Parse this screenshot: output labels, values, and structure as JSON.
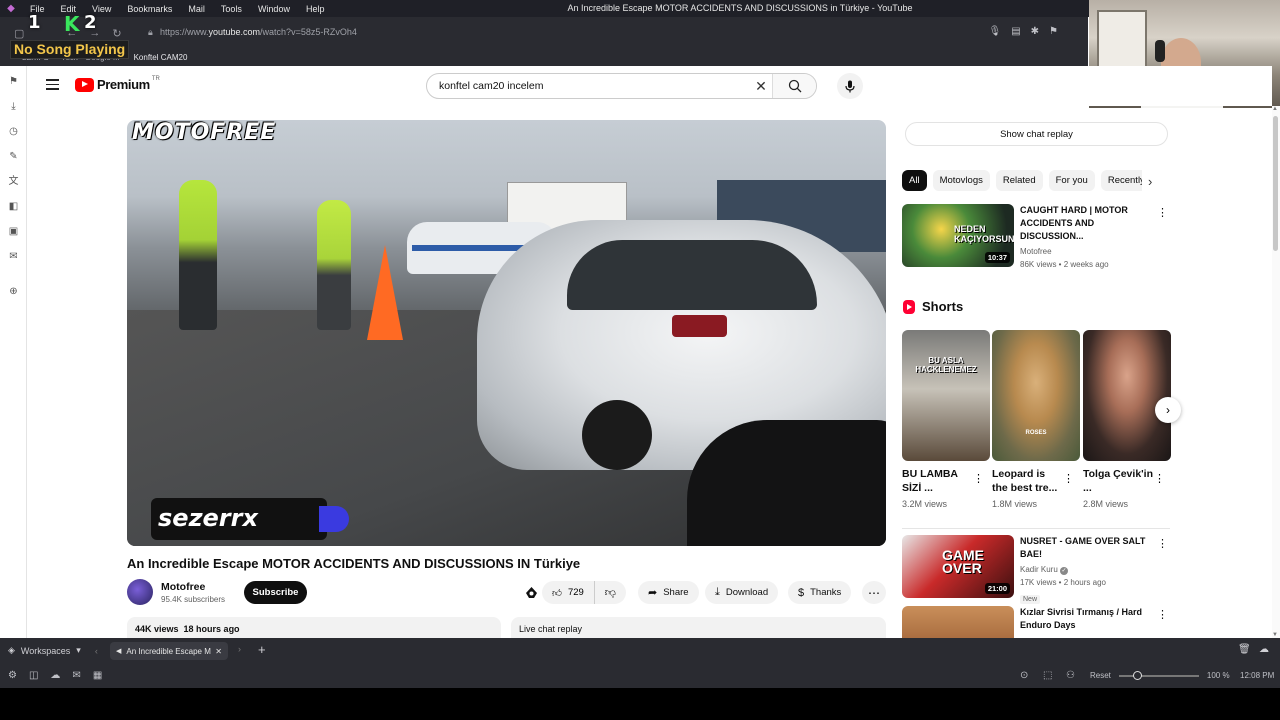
{
  "os_menu": {
    "items": [
      "File",
      "Edit",
      "View",
      "Bookmarks",
      "Mail",
      "Tools",
      "Window",
      "Help"
    ],
    "window_title": "An Incredible Escape MOTOR ACCIDENTS AND DISCUSSIONS in Türkiye - YouTube"
  },
  "browser": {
    "url_prefix": "https://www.",
    "url_domain": "youtube.com",
    "url_path": "/watch?v=58z5-RZvOh4",
    "bookmarks": [
      "LEMFS",
      "Kick - Google ...",
      "Konftel CAM20"
    ]
  },
  "overlay": {
    "num1": "1",
    "num2": "2",
    "k_letter": "K",
    "song": "No Song Playing"
  },
  "youtube": {
    "brand": "Premium",
    "country": "TR",
    "search_query": "konftel cam20 incelem"
  },
  "video": {
    "watermark_top": "MOTOFREE",
    "watermark_bottom": "sezerrx",
    "title": "An Incredible Escape MOTOR ACCIDENTS AND DISCUSSIONS IN Türkiye",
    "channel_name": "Motofree",
    "subscribers": "95.4K subscribers",
    "subscribe_label": "Subscribe",
    "likes": "729",
    "share_label": "Share",
    "download_label": "Download",
    "thanks_label": "Thanks",
    "views": "44K views",
    "age": "18 hours ago",
    "live_chat": "Live chat replay"
  },
  "sidebar_right": {
    "chat_replay": "Show chat replay",
    "chips": [
      "All",
      "Motovlogs",
      "Related",
      "For you",
      "Recently uploaded"
    ],
    "rec1": {
      "title": "CAUGHT HARD | MOTOR ACCIDENTS AND DISCUSSION...",
      "channel": "Motofree",
      "meta": "86K views • 2 weeks ago",
      "duration": "10:37",
      "thumb_text": "NEDEN KAÇIYORSUN"
    },
    "shorts_title": "Shorts",
    "shorts": [
      {
        "title": "BU LAMBA SİZİ ...",
        "views": "3.2M views",
        "overlay": "BU ASLA HACKLENEMEZ"
      },
      {
        "title": "Leopard is the best tre...",
        "views": "1.8M views",
        "overlay": "ROSES"
      },
      {
        "title": "Tolga Çevik'in ...",
        "views": "2.8M views",
        "overlay": ""
      }
    ],
    "rec2": {
      "title": "NUSRET - GAME OVER SALT BAE!",
      "channel": "Kadir Kuru",
      "meta": "17K views • 2 hours ago",
      "badge": "New",
      "duration": "21:00",
      "thumb_text": "GAME OVER"
    },
    "rec3": {
      "title": "Kızlar Sivrisi Tırmanış / Hard Enduro Days"
    }
  },
  "bottom": {
    "workspaces": "Workspaces",
    "tab_title": "An Incredible Escape M",
    "reset": "Reset",
    "zoom": "100 %",
    "clock": "12:08 PM"
  }
}
